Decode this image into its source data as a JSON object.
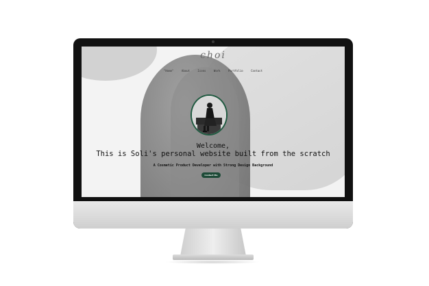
{
  "site": {
    "logo": "choi",
    "nav": [
      "\"Home\"",
      "About",
      "Icons",
      "Work",
      "Portfolio",
      "Contact"
    ],
    "welcome": "Welcome,",
    "headline": "This is Soli's personal website built from the scratch",
    "subtitle": "A Cosmetic Product Developer with Strong Design Background",
    "contact_button": "Contact Me"
  },
  "colors": {
    "accent": "#1d4a37",
    "text": "#111111",
    "bezel": "#111111",
    "screen_bg": "#f3f3f3"
  },
  "icons": {
    "profile": "person-seated-photo"
  }
}
